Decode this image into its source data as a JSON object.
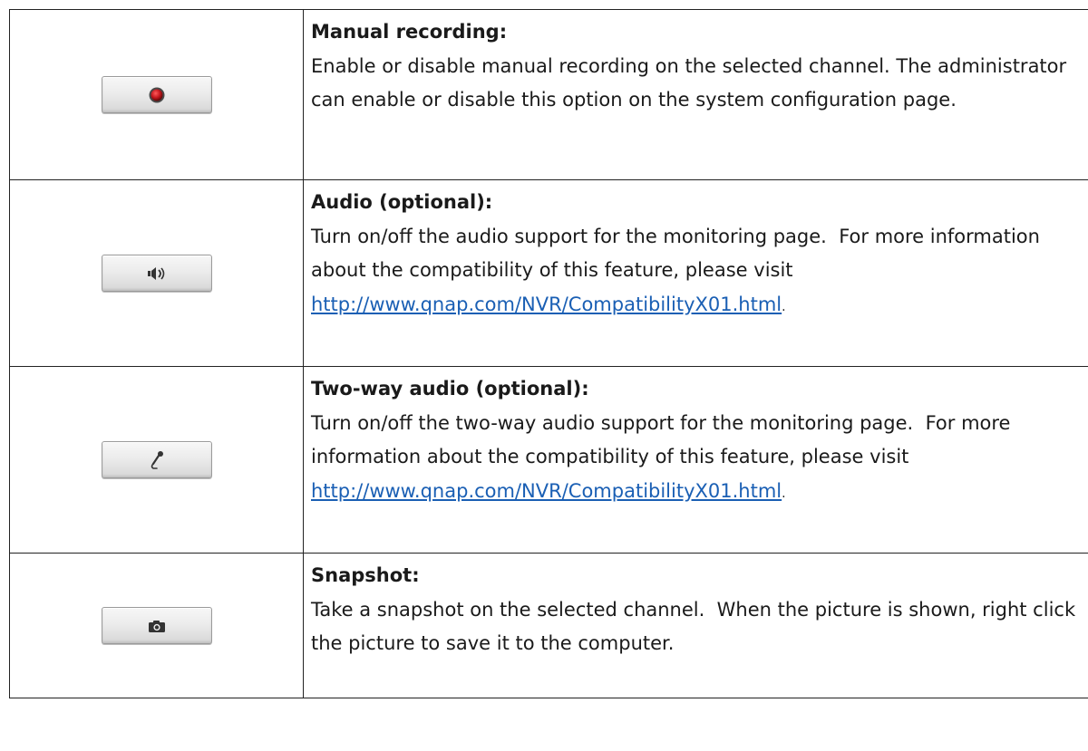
{
  "rows": [
    {
      "icon": "record-icon",
      "title": "Manual recording:",
      "body": "Enable or disable manual recording on the selected channel. The administrator can enable or disable this option on the system configuration page."
    },
    {
      "icon": "speaker-icon",
      "title": "Audio (optional):",
      "body": "Turn on/off the audio support for the monitoring page.  For more information about the compatibility of this feature, please visit",
      "link": "http://www.qnap.com/NVR/CompatibilityX01.html",
      "link_suffix": "."
    },
    {
      "icon": "microphone-icon",
      "title": "Two-way audio (optional):",
      "body": "Turn on/off the two-way audio support for the monitoring page.  For more information about the compatibility of this feature, please visit",
      "link": "http://www.qnap.com/NVR/CompatibilityX01.html",
      "link_suffix": "."
    },
    {
      "icon": "camera-icon",
      "title": "Snapshot:",
      "body": "Take a snapshot on the selected channel.  When the picture is shown, right click the picture to save it to the computer."
    }
  ],
  "colors": {
    "link": "#1a5fb4",
    "record_dot": "#c0141b",
    "border": "#222222"
  }
}
